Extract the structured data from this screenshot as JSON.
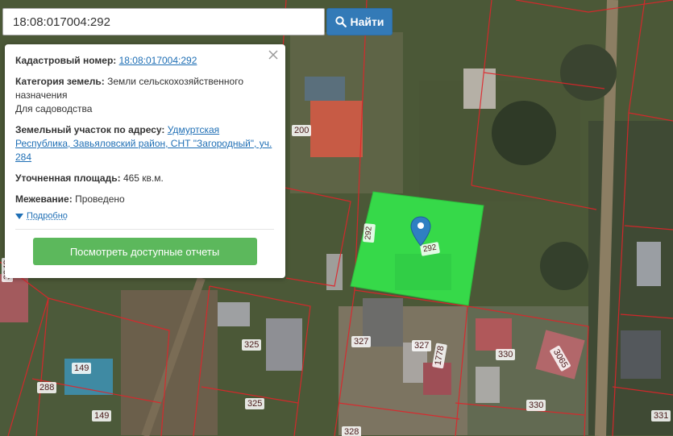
{
  "search": {
    "value": "18:08:017004:292",
    "button_label": "Найти"
  },
  "popup": {
    "cadastral_label": "Кадастровый номер:",
    "cadastral_value": "18:08:017004:292",
    "category_label": "Категория земель:",
    "category_value": "Земли сельскохозяйственного назначения",
    "usage": "Для садоводства",
    "address_label": "Земельный участок по адресу:",
    "address_value": "Удмуртская Республика, Завьяловский район, СНТ \"Загородный\", уч. 284",
    "area_label": "Уточненная площадь:",
    "area_value": "465 кв.м.",
    "survey_label": "Межевание:",
    "survey_value": "Проведено",
    "details_label": "Подробно",
    "report_button": "Посмотреть доступные отчеты"
  },
  "map": {
    "highlight_color": "#35e04a",
    "highlight_parcel_labels": [
      "292",
      "292"
    ],
    "parcel_labels": [
      "200",
      "327",
      "327",
      "330",
      "1778",
      "3065",
      "325",
      "325",
      "149",
      "149",
      "288",
      "328",
      "330",
      "331",
      "3048"
    ]
  }
}
